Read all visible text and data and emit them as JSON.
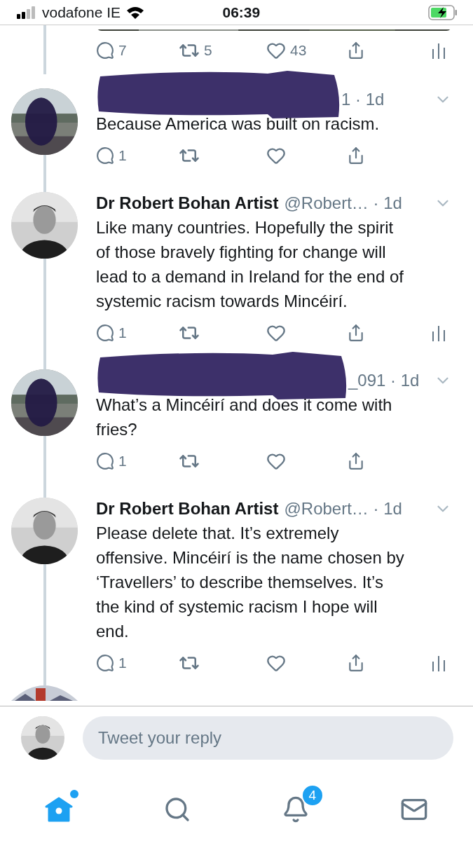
{
  "status_bar": {
    "carrier": "vodafone IE",
    "time": "06:39"
  },
  "top_actions": {
    "replies": "7",
    "retweets": "5",
    "likes": "43",
    "analytics": true
  },
  "tweets": [
    {
      "redacted": true,
      "visible_tail": "1 · 1d",
      "lines": [
        "Because America was built on racism."
      ],
      "replies": "1",
      "analytics": false
    },
    {
      "redacted": false,
      "name": "Dr Robert Bohan Artist",
      "handle": "@Robert…",
      "time": "· 1d",
      "lines": [
        "Like many countries. Hopefully the spirit",
        "of those bravely fighting for change will",
        "lead to a demand in Ireland for the end of",
        "systemic racism towards Mincéirí."
      ],
      "replies": "1",
      "analytics": true
    },
    {
      "redacted": true,
      "visible_tail": "_091 · 1d",
      "lines": [
        "What’s a Mincéirí and does it come with",
        "fries?"
      ],
      "replies": "1",
      "analytics": false
    },
    {
      "redacted": false,
      "name": "Dr Robert Bohan Artist",
      "handle": "@Robert…",
      "time": "· 1d",
      "lines": [
        "Please delete that. It’s extremely",
        "offensive. Mincéirí is the name chosen by",
        "‘Travellers’ to describe themselves. It’s",
        "the kind of systemic racism I hope will",
        "end."
      ],
      "replies": "1",
      "analytics": true
    }
  ],
  "reply": {
    "placeholder": "Tweet your reply"
  },
  "tabs": [
    {
      "kind": "home",
      "selected": true,
      "dot": true
    },
    {
      "kind": "search",
      "selected": false,
      "dot": false
    },
    {
      "kind": "notifications",
      "selected": false,
      "dot": false,
      "badge": "4"
    },
    {
      "kind": "messages",
      "selected": false,
      "dot": false
    }
  ]
}
